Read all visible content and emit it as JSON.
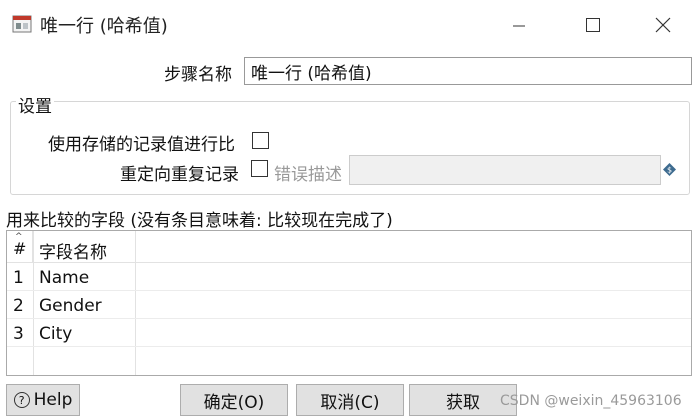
{
  "window": {
    "title": "唯一行 (哈希值)",
    "icon": "kettle-step-icon"
  },
  "step": {
    "label": "步骤名称",
    "value": "唯一行 (哈希值)"
  },
  "settings": {
    "group_title": "设置",
    "use_stored_label": "使用存储的记录值进行比",
    "redirect_label": "重定向重复记录",
    "error_desc_label": "错误描述",
    "error_desc_value": ""
  },
  "fields": {
    "caption": "用来比较的字段 (没有条目意味着: 比较现在完成了)",
    "headers": [
      "#",
      "字段名称"
    ],
    "rows": [
      {
        "num": "1",
        "name": "Name"
      },
      {
        "num": "2",
        "name": "Gender"
      },
      {
        "num": "3",
        "name": "City"
      }
    ]
  },
  "buttons": {
    "help": "Help",
    "ok": "确定(O)",
    "cancel": "取消(C)",
    "get": "获取"
  },
  "watermark": "CSDN @weixin_45963106"
}
